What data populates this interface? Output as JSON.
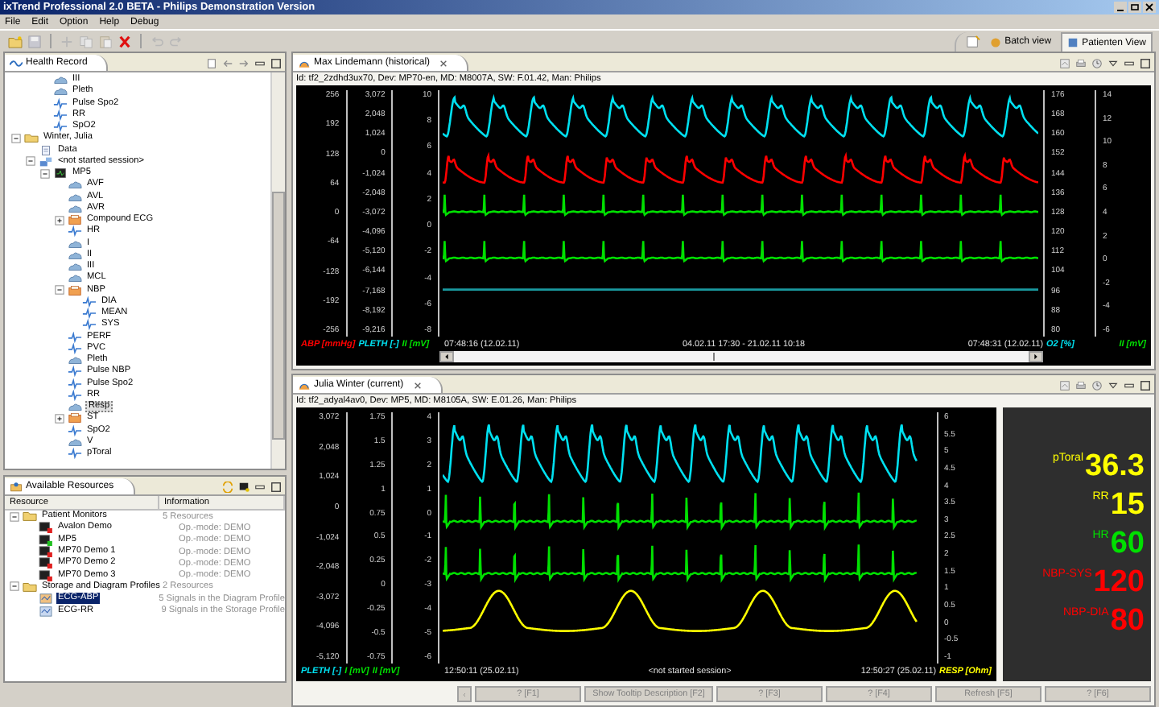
{
  "window": {
    "title": "ixTrend Professional 2.0 BETA - Philips Demonstration Version"
  },
  "menu": [
    "File",
    "Edit",
    "Option",
    "Help",
    "Debug"
  ],
  "perspectives": [
    {
      "label": "Batch view",
      "selected": false
    },
    {
      "label": "Patienten View",
      "selected": true
    }
  ],
  "health_record": {
    "title": "Health Record",
    "fragment": [
      {
        "label": "III",
        "kind": "wave",
        "selected": false
      },
      {
        "label": "Pleth",
        "kind": "wave",
        "selected": false
      },
      {
        "label": "Pulse Spo2",
        "kind": "trend",
        "selected": false
      },
      {
        "label": "RR",
        "kind": "trend",
        "selected": false
      },
      {
        "label": "SpO2",
        "kind": "trend",
        "selected": false
      }
    ],
    "tree": [
      {
        "label": "Winter, Julia",
        "kind": "patient",
        "expanded": true,
        "selected": false,
        "children": [
          {
            "label": "Data",
            "kind": "data",
            "selected": false
          },
          {
            "label": "<not started session>",
            "kind": "session",
            "expanded": true,
            "selected": false,
            "children": [
              {
                "label": "MP5",
                "kind": "monitor",
                "expanded": true,
                "selected": false,
                "children": [
                  {
                    "label": "AVF",
                    "kind": "wave",
                    "selected": false
                  },
                  {
                    "label": "AVL",
                    "kind": "wave",
                    "selected": false
                  },
                  {
                    "label": "AVR",
                    "kind": "wave",
                    "selected": false
                  },
                  {
                    "label": "Compound ECG",
                    "kind": "group",
                    "expanded": false,
                    "selected": false
                  },
                  {
                    "label": "HR",
                    "kind": "trend",
                    "selected": false
                  },
                  {
                    "label": "I",
                    "kind": "wave",
                    "selected": false
                  },
                  {
                    "label": "II",
                    "kind": "wave",
                    "selected": false
                  },
                  {
                    "label": "III",
                    "kind": "wave",
                    "selected": false
                  },
                  {
                    "label": "MCL",
                    "kind": "wave",
                    "selected": false
                  },
                  {
                    "label": "NBP",
                    "kind": "group",
                    "expanded": true,
                    "selected": false,
                    "children": [
                      {
                        "label": "DIA",
                        "kind": "trend",
                        "selected": false
                      },
                      {
                        "label": "MEAN",
                        "kind": "trend",
                        "selected": false
                      },
                      {
                        "label": "SYS",
                        "kind": "trend",
                        "selected": false
                      }
                    ]
                  },
                  {
                    "label": "PERF",
                    "kind": "trend",
                    "selected": false
                  },
                  {
                    "label": "PVC",
                    "kind": "trend",
                    "selected": false
                  },
                  {
                    "label": "Pleth",
                    "kind": "wave",
                    "selected": false
                  },
                  {
                    "label": "Pulse NBP",
                    "kind": "trend",
                    "selected": false
                  },
                  {
                    "label": "Pulse Spo2",
                    "kind": "trend",
                    "selected": false
                  },
                  {
                    "label": "RR",
                    "kind": "trend",
                    "selected": false
                  },
                  {
                    "label": "Resp",
                    "kind": "wave",
                    "selected": true
                  },
                  {
                    "label": "ST",
                    "kind": "group",
                    "expanded": false,
                    "selected": false
                  },
                  {
                    "label": "SpO2",
                    "kind": "trend",
                    "selected": false
                  },
                  {
                    "label": "V",
                    "kind": "wave",
                    "selected": false
                  },
                  {
                    "label": "pToral",
                    "kind": "trend",
                    "selected": false
                  }
                ]
              }
            ]
          }
        ]
      }
    ]
  },
  "resources": {
    "title": "Available Resources",
    "columns": [
      "Resource",
      "Information"
    ],
    "rows": [
      {
        "label": "Patient Monitors",
        "info": "5 Resources",
        "kind": "folder",
        "expanded": true,
        "selected": false,
        "children": [
          {
            "label": "Avalon Demo",
            "info": "Op.-mode: DEMO",
            "kind": "monitor",
            "color": "#e02020",
            "selected": false
          },
          {
            "label": "MP5",
            "info": "Op.-mode: DEMO",
            "kind": "monitor",
            "color": "#20c020",
            "selected": false
          },
          {
            "label": "MP70 Demo 1",
            "info": "Op.-mode: DEMO",
            "kind": "monitor",
            "color": "#e02020",
            "selected": false
          },
          {
            "label": "MP70 Demo 2",
            "info": "Op.-mode: DEMO",
            "kind": "monitor",
            "color": "#e02020",
            "selected": false
          },
          {
            "label": "MP70 Demo 3",
            "info": "Op.-mode: DEMO",
            "kind": "monitor",
            "color": "#e02020",
            "selected": false
          }
        ]
      },
      {
        "label": "Storage and Diagram Profiles",
        "info": "2 Resources",
        "kind": "folder",
        "expanded": true,
        "selected": false,
        "children": [
          {
            "label": "ECG-ABP",
            "info": "5 Signals in the Diagram Profile",
            "kind": "diagram",
            "selected": true
          },
          {
            "label": "ECG-RR",
            "info": "9 Signals in the Storage Profile",
            "kind": "storage",
            "selected": false
          }
        ]
      }
    ]
  },
  "views": [
    {
      "title": "Max Lindemann (historical)",
      "info": "Id: tf2_2zdhd3ux70, Dev: MP70-en, MD: M8007A, SW: F.01.42, Man: Philips",
      "scrollbar": true,
      "left_axes": [
        [
          "256",
          "192",
          "128",
          "64",
          "0",
          "-64",
          "-128",
          "-192",
          "-256"
        ],
        [
          "3,072",
          "2,048",
          "1,024",
          "0",
          "-1,024",
          "-2,048",
          "-3,072",
          "-4,096",
          "-5,120",
          "-6,144",
          "-7,168",
          "-8,192",
          "-9,216"
        ],
        [
          "10",
          "8",
          "6",
          "4",
          "2",
          "0",
          "-2",
          "-4",
          "-6",
          "-8"
        ]
      ],
      "right_axes": [
        [
          "176",
          "168",
          "160",
          "152",
          "144",
          "136",
          "128",
          "120",
          "112",
          "104",
          "96",
          "88",
          "80"
        ],
        [
          "14",
          "12",
          "10",
          "8",
          "6",
          "4",
          "2",
          "0",
          "-2",
          "-4",
          "-6"
        ]
      ],
      "left_legend": [
        {
          "text": "ABP [mmHg]",
          "color": "#ff0000"
        },
        {
          "text": "PLETH [-]",
          "color": "#00e0f0"
        },
        {
          "text": "II [mV]",
          "color": "#00e000"
        }
      ],
      "start": "07:48:16 (12.02.11)",
      "center": "04.02.11 17:30 - 21.02.11 10:18",
      "end": "07:48:31 (12.02.11)",
      "right_legend": [
        {
          "text": "O2 [%]",
          "color": "#00e0f0"
        },
        {
          "text": "II [mV]",
          "color": "#00e000"
        }
      ]
    },
    {
      "title": "Julia Winter (current)",
      "info": "Id: tf2_adyal4av0, Dev: MP5, MD: M8105A, SW: E.01.26, Man: Philips",
      "left_axes": [
        [
          "3,072",
          "2,048",
          "1,024",
          "0",
          "-1,024",
          "-2,048",
          "-3,072",
          "-4,096",
          "-5,120"
        ],
        [
          "1.75",
          "1.5",
          "1.25",
          "1",
          "0.75",
          "0.5",
          "0.25",
          "0",
          "-0.25",
          "-0.5",
          "-0.75"
        ],
        [
          "4",
          "3",
          "2",
          "1",
          "0",
          "-1",
          "-2",
          "-3",
          "-4",
          "-5",
          "-6"
        ]
      ],
      "right_axes": [
        [
          "6",
          "5.5",
          "5",
          "4.5",
          "4",
          "3.5",
          "3",
          "2.5",
          "2",
          "1.5",
          "1",
          "0.5",
          "0",
          "-0.5",
          "-1"
        ]
      ],
      "left_legend": [
        {
          "text": "PLETH [-]",
          "color": "#00e0f0"
        },
        {
          "text": "I [mV]",
          "color": "#00e000"
        },
        {
          "text": "II [mV]",
          "color": "#00e000"
        }
      ],
      "start": "12:50:11 (25.02.11)",
      "center": "<not started session>",
      "end": "12:50:27 (25.02.11)",
      "right_legend": [
        {
          "text": "RESP [Ohm]",
          "color": "#ffff00"
        }
      ],
      "vitals": [
        {
          "label": "pToral",
          "value": "36.3",
          "color": "#ffff00"
        },
        {
          "label": "RR",
          "value": "15",
          "color": "#ffff00"
        },
        {
          "label": "HR",
          "value": "60",
          "color": "#00e000"
        },
        {
          "label": "NBP-SYS",
          "value": "120",
          "color": "#ff0000"
        },
        {
          "label": "NBP-DIA",
          "value": "80",
          "color": "#ff0000"
        }
      ]
    }
  ],
  "function_keys": [
    "? [F1]",
    "Show Tooltip Description [F2]",
    "? [F3]",
    "? [F4]",
    "Refresh [F5]",
    "? [F6]"
  ]
}
